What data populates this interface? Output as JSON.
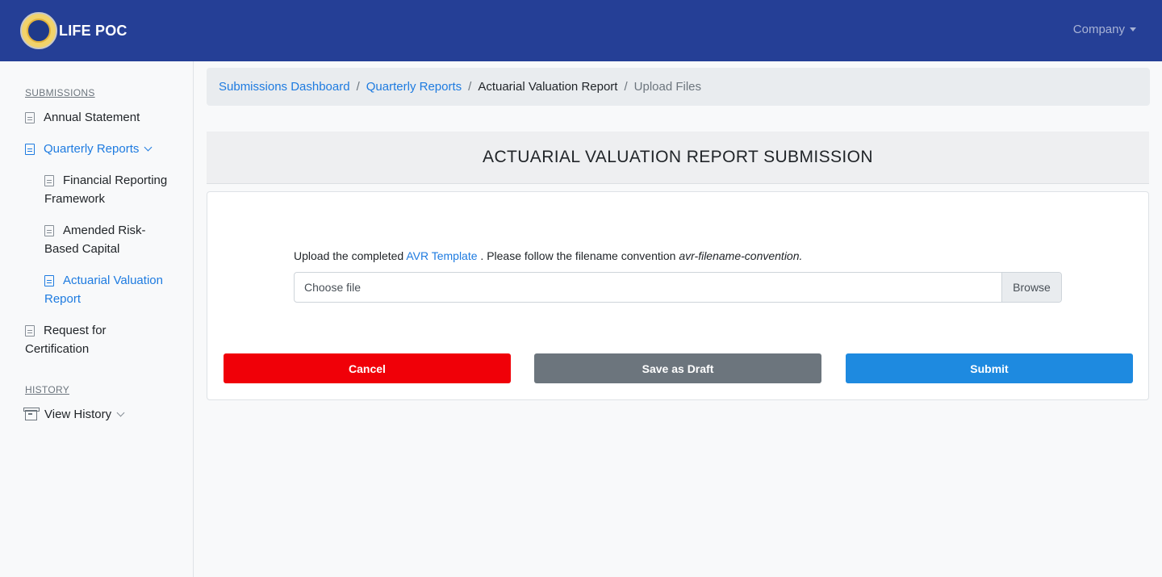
{
  "navbar": {
    "brand_title": "LIFE POC",
    "logo_icon": "seal-logo",
    "company_label": "Company",
    "colors": {
      "background": "#253f96"
    }
  },
  "sidebar": {
    "submissions_heading": "SUBMISSIONS",
    "items": {
      "annual_statement": "Annual Statement",
      "quarterly_reports": "Quarterly Reports",
      "financial_reporting_line1": "Financial Reporting",
      "financial_reporting_line2": "Framework",
      "amended_risk_line1": "Amended Risk-",
      "amended_risk_line2": "Based Capital",
      "actuarial_line1": "Actuarial Valuation",
      "actuarial_line2": "Report",
      "request_line1": "Request for",
      "request_line2": "Certification"
    },
    "history_heading": "HISTORY",
    "view_history": "View History"
  },
  "breadcrumb": {
    "items": [
      "Submissions Dashboard",
      "Quarterly Reports",
      "Actuarial Valuation Report",
      "Upload Files"
    ],
    "separator": "/"
  },
  "card": {
    "title": "ACTUARIAL VALUATION REPORT SUBMISSION",
    "instruction_prefix": "Upload the completed ",
    "template_link": "AVR Template",
    "instruction_middle": " . Please follow the filename convention ",
    "filename_convention": "avr-filename-convention.",
    "file_placeholder": "Choose file",
    "browse_label": "Browse"
  },
  "actions": {
    "cancel": "Cancel",
    "save_draft": "Save as Draft",
    "submit": "Submit",
    "colors": {
      "cancel": "#f00008",
      "draft": "#6c757d",
      "submit": "#1e8ae0"
    }
  }
}
